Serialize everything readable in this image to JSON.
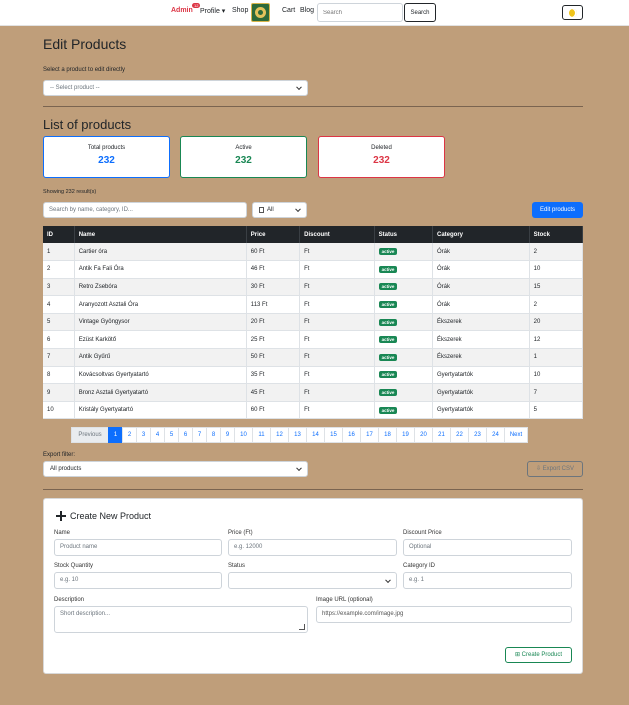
{
  "nav": {
    "admin": "Admin",
    "admin_badge": "12",
    "profile": "Profile ▾",
    "shop": "Shop",
    "cart": "Cart",
    "blog": "Blog",
    "search_placeholder": "Search",
    "search_button": "Search"
  },
  "edit": {
    "title": "Edit Products",
    "select_label": "Select a product to edit directly",
    "select_value": "-- Select product --"
  },
  "list": {
    "title": "List of products",
    "cards": [
      {
        "label": "Total products",
        "value": "232"
      },
      {
        "label": "Active",
        "value": "232"
      },
      {
        "label": "Deleted",
        "value": "232"
      }
    ],
    "showing": "Showing 232 result(s)",
    "search_placeholder": "Search by name, category, ID...",
    "filter_value": "All",
    "edit_button": "Edit products"
  },
  "table": {
    "headers": [
      "ID",
      "Name",
      "Price",
      "Discount",
      "Status",
      "Category",
      "Stock"
    ],
    "rows": [
      [
        "1",
        "Cartier óra",
        "60 Ft",
        "Ft",
        "active",
        "Órák",
        "2"
      ],
      [
        "2",
        "Antik Fa Fali Óra",
        "46 Ft",
        "Ft",
        "active",
        "Órák",
        "10"
      ],
      [
        "3",
        "Retro Zsebóra",
        "30 Ft",
        "Ft",
        "active",
        "Órák",
        "15"
      ],
      [
        "4",
        "Aranyozott Asztali Óra",
        "113 Ft",
        "Ft",
        "active",
        "Órák",
        "2"
      ],
      [
        "5",
        "Vintage Gyöngysor",
        "20 Ft",
        "Ft",
        "active",
        "Ékszerek",
        "20"
      ],
      [
        "6",
        "Ezüst Karkötő",
        "25 Ft",
        "Ft",
        "active",
        "Ékszerek",
        "12"
      ],
      [
        "7",
        "Antik Gyűrű",
        "50 Ft",
        "Ft",
        "active",
        "Ékszerek",
        "1"
      ],
      [
        "8",
        "Kovácsoltvas Gyertyatartó",
        "35 Ft",
        "Ft",
        "active",
        "Gyertyatartók",
        "10"
      ],
      [
        "9",
        "Bronz Asztali Gyertyatartó",
        "45 Ft",
        "Ft",
        "active",
        "Gyertyatartók",
        "7"
      ],
      [
        "10",
        "Kristály Gyertyatartó",
        "60 Ft",
        "Ft",
        "active",
        "Gyertyatartók",
        "5"
      ]
    ]
  },
  "pagination": {
    "previous": "Previous",
    "pages": [
      "1",
      "2",
      "3",
      "4",
      "5",
      "6",
      "7",
      "8",
      "9",
      "10",
      "11",
      "12",
      "13",
      "14",
      "15",
      "16",
      "17",
      "18",
      "19",
      "20",
      "21",
      "22",
      "23",
      "24"
    ],
    "next": "Next",
    "active_page": "1"
  },
  "export": {
    "label": "Export filter:",
    "value": "All products",
    "button": "Export CSV"
  },
  "create": {
    "title": "Create New Product",
    "name_label": "Name",
    "name_placeholder": "Product name",
    "price_label": "Price (Ft)",
    "price_placeholder": "e.g. 12000",
    "discount_label": "Discount Price",
    "discount_placeholder": "Optional",
    "stock_label": "Stock Quantity",
    "stock_placeholder": "e.g. 10",
    "status_label": "Status",
    "category_label": "Category ID",
    "category_placeholder": "e.g. 1",
    "description_label": "Description",
    "description_placeholder": "Short description...",
    "image_label": "Image URL (optional)",
    "image_placeholder": "https://example.com/image.jpg",
    "button": "Create Product"
  }
}
